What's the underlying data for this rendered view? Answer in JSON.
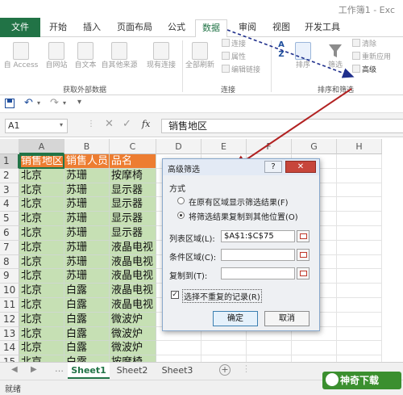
{
  "window": {
    "title": "工作簿1 - Exc"
  },
  "tabs": [
    "文件",
    "开始",
    "插入",
    "页面布局",
    "公式",
    "数据",
    "审阅",
    "视图",
    "开发工具"
  ],
  "ribbon": {
    "ext_group": {
      "buttons": [
        "自 Access",
        "自网站",
        "自文本",
        "自其他来源",
        "现有连接"
      ],
      "label": "获取外部数据"
    },
    "conn_group": {
      "refresh_all": "全部刷新",
      "connections": "连接",
      "properties": "属性",
      "edit_links": "编辑链接",
      "label": "连接"
    },
    "sort_group": {
      "sort": "排序",
      "filter": "筛选",
      "clear": "清除",
      "reapply": "重新应用",
      "advanced": "高级",
      "label": "排序和筛选"
    }
  },
  "formula_bar": {
    "name_box": "A1",
    "fx": "fx",
    "content": "销售地区"
  },
  "grid": {
    "columns": [
      "A",
      "B",
      "C",
      "D",
      "E",
      "F",
      "G",
      "H"
    ],
    "rows": [
      [
        "销售地区",
        "销售人员",
        "品名"
      ],
      [
        "北京",
        "苏珊",
        "按摩椅"
      ],
      [
        "北京",
        "苏珊",
        "显示器"
      ],
      [
        "北京",
        "苏珊",
        "显示器"
      ],
      [
        "北京",
        "苏珊",
        "显示器"
      ],
      [
        "北京",
        "苏珊",
        "显示器"
      ],
      [
        "北京",
        "苏珊",
        "液晶电视"
      ],
      [
        "北京",
        "苏珊",
        "液晶电视"
      ],
      [
        "北京",
        "苏珊",
        "液晶电视"
      ],
      [
        "北京",
        "白露",
        "液晶电视"
      ],
      [
        "北京",
        "白露",
        "液晶电视"
      ],
      [
        "北京",
        "白露",
        "微波炉"
      ],
      [
        "北京",
        "白露",
        "微波炉"
      ],
      [
        "北京",
        "白露",
        "微波炉"
      ],
      [
        "北京",
        "白露",
        "按摩椅"
      ]
    ]
  },
  "sheets": [
    "Sheet1",
    "Sheet2",
    "Sheet3"
  ],
  "status": {
    "ready": "就绪"
  },
  "dialog": {
    "title": "高级筛选",
    "help": "?",
    "method_label": "方式",
    "option1": "在原有区域显示筛选结果(F)",
    "option2": "将筛选结果复制到其他位置(O)",
    "list_range_label": "列表区域(L):",
    "list_range_value": "$A$1:$C$75",
    "criteria_label": "条件区域(C):",
    "criteria_value": "",
    "copy_to_label": "复制到(T):",
    "copy_to_value": "",
    "unique_label": "选择不重复的记录(R)",
    "unique_checked": true,
    "ok": "确定",
    "cancel": "取消"
  },
  "watermark": {
    "text": "神奇下载"
  },
  "colors": {
    "excel_green": "#217346",
    "header_fill": "#ed7d31",
    "data_fill": "#c6e0b4",
    "arrow": "#b22222",
    "dash_arrow": "#1f2f8c"
  }
}
